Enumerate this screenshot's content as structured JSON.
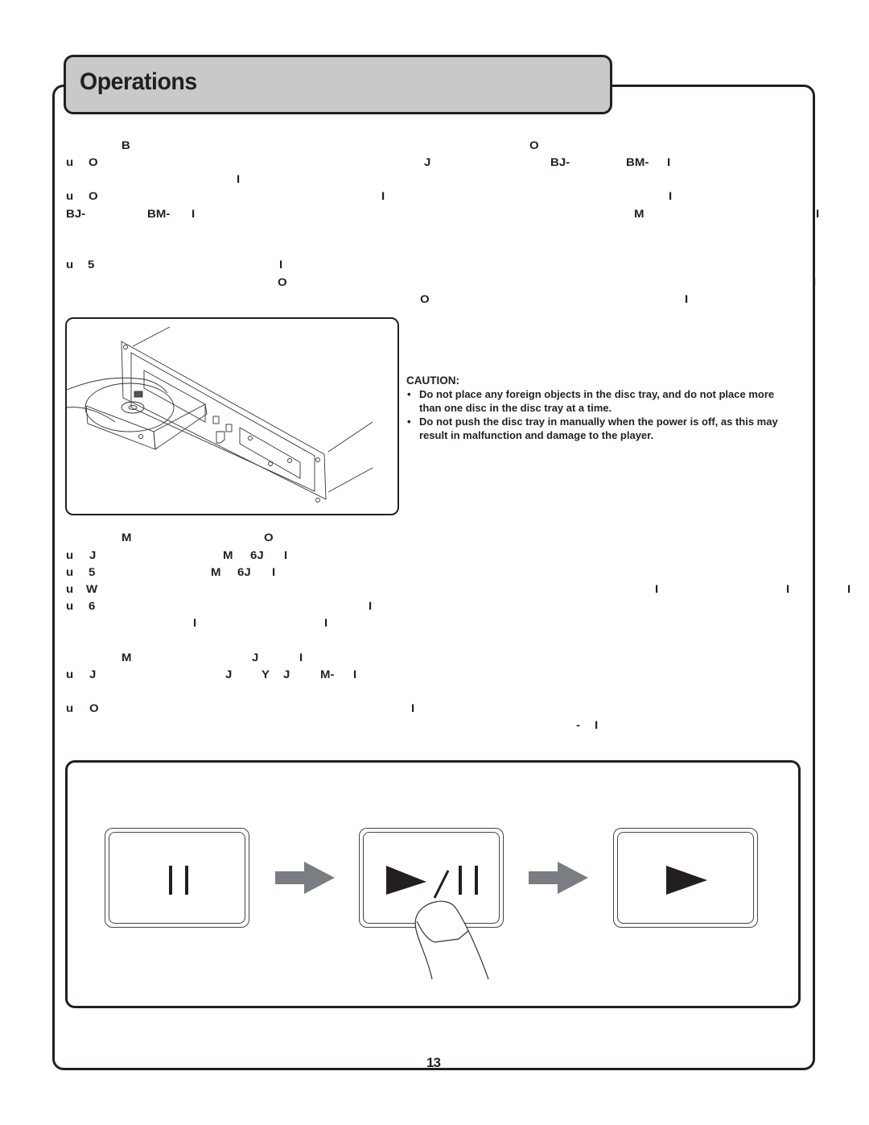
{
  "page": {
    "title": "Operations",
    "page_number": "13"
  },
  "garbled_text": {
    "line1": [
      "B",
      "O"
    ],
    "line2": [
      "u",
      "O",
      "J",
      "BJ-",
      "BM-",
      "I"
    ],
    "line3": [
      "I"
    ],
    "line4": [
      "u",
      "O",
      "I",
      "I"
    ],
    "line5": [
      "BJ-",
      "BM-",
      "I",
      "M",
      "I"
    ],
    "line6": [
      "u",
      "5",
      "I"
    ],
    "line7": [
      "O",
      "I"
    ],
    "line8": [
      "O",
      "I"
    ],
    "line9": [
      "M",
      "O"
    ],
    "line10": [
      "u",
      "J",
      "M",
      "6J",
      "I"
    ],
    "line11": [
      "u",
      "5",
      "M",
      "6J",
      "I"
    ],
    "line12": [
      "u",
      "W",
      "I",
      "I",
      "I"
    ],
    "line13": [
      "u",
      "6",
      "I"
    ],
    "line14": [
      "I",
      "I"
    ],
    "line15": [
      "M",
      "J",
      "I"
    ],
    "line16": [
      "u",
      "J",
      "J",
      "Y",
      "J",
      "M-",
      "I"
    ],
    "line17": [
      "u",
      "O",
      "I"
    ],
    "line18": [
      "-",
      "I"
    ]
  },
  "caution": {
    "heading": "CAUTION:",
    "items": [
      "Do not place any foreign objects in the disc tray, and do not place more than one disc in the disc tray at a time.",
      "Do not push the disc tray in manually when the power is off, as this may result in malfunction and damage to the player."
    ]
  },
  "diagram": {
    "keys": [
      {
        "name": "pause",
        "icon": "pause-icon",
        "symbol": "II"
      },
      {
        "name": "play-pause",
        "icon": "play-pause-icon",
        "symbol": "▶/II"
      },
      {
        "name": "play",
        "icon": "play-icon",
        "symbol": "▶"
      }
    ],
    "arrow_color": "#7a7d82",
    "accent_color": "#231f20",
    "title_tab_color": "#c8c9cb"
  }
}
